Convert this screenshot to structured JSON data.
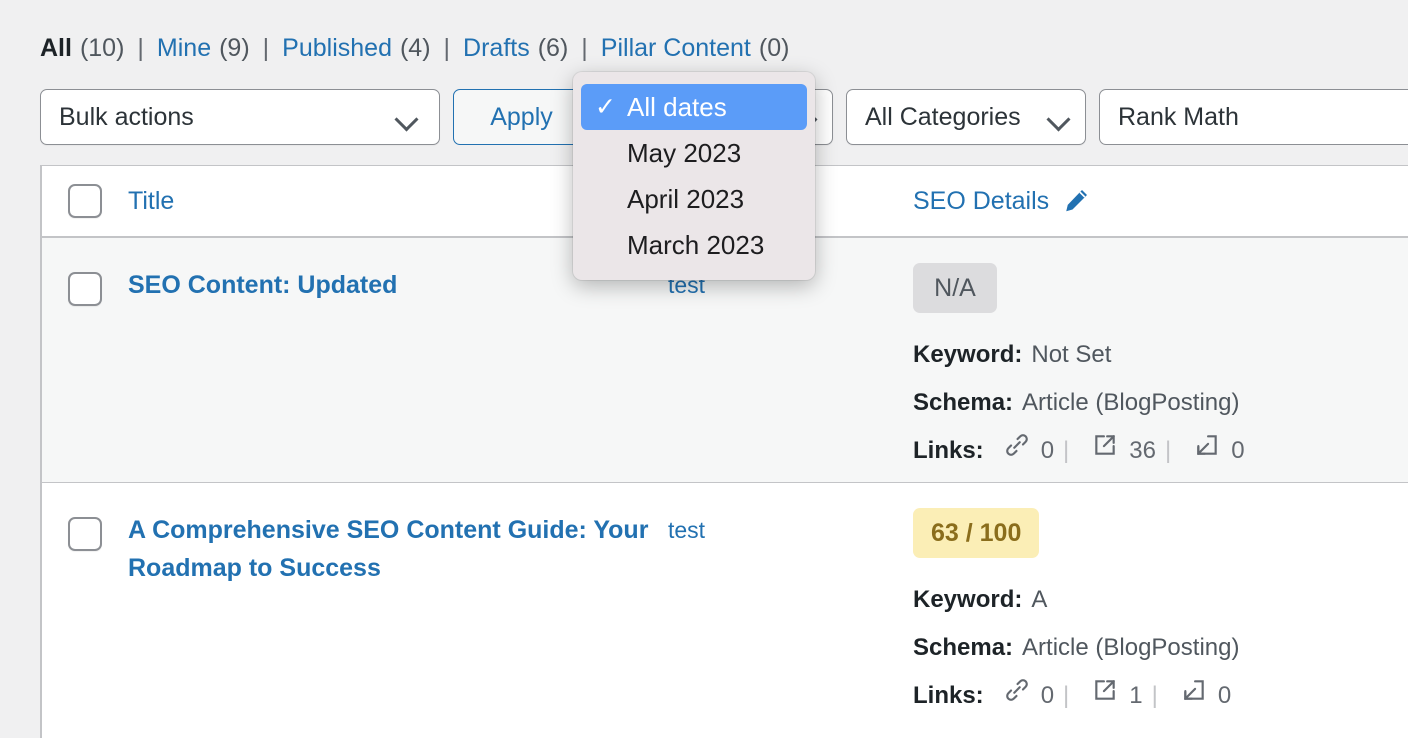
{
  "filters": {
    "separator": "|",
    "items": [
      {
        "label": "All",
        "count": "(10)",
        "current": true
      },
      {
        "label": "Mine",
        "count": "(9)",
        "current": false
      },
      {
        "label": "Published",
        "count": "(4)",
        "current": false
      },
      {
        "label": "Drafts",
        "count": "(6)",
        "current": false
      },
      {
        "label": "Pillar Content",
        "count": "(0)",
        "current": false
      }
    ]
  },
  "toolbar": {
    "bulk_actions_value": "Bulk actions",
    "apply_label": "Apply",
    "date_filter_value": "All dates",
    "category_filter_value": "All Categories",
    "rank_math_value": "Rank Math"
  },
  "date_dropdown": {
    "checkmark": "✓",
    "options": [
      {
        "label": "All dates",
        "selected": true
      },
      {
        "label": "May 2023",
        "selected": false
      },
      {
        "label": "April 2023",
        "selected": false
      },
      {
        "label": "March 2023",
        "selected": false
      }
    ]
  },
  "table": {
    "headers": {
      "title": "Title",
      "seo_details": "SEO Details"
    },
    "labels": {
      "keyword": "Keyword:",
      "schema": "Schema:",
      "links": "Links:",
      "separator": "|"
    },
    "rows": [
      {
        "title": "SEO Content: Updated",
        "category": "test",
        "score": "N/A",
        "score_type": "na",
        "keyword": "Not Set",
        "schema": "Article (BlogPosting)",
        "links_internal": "0",
        "links_external": "36",
        "links_incoming": "0"
      },
      {
        "title": "A Comprehensive SEO Content Guide: Your Roadmap to Success",
        "category": "test",
        "score": "63 / 100",
        "score_type": "ok",
        "keyword": "A",
        "schema": "Article (BlogPosting)",
        "links_internal": "0",
        "links_external": "1",
        "links_incoming": "0"
      }
    ]
  },
  "colors": {
    "link": "#2271b1",
    "page_bg": "#f0f0f1",
    "row_alt_bg": "#f6f7f7",
    "highlight_blue": "#5b9cf8",
    "score_ok_bg": "#fbeeb6",
    "score_ok_text": "#8a6d1c",
    "score_na_bg": "#dcdcde"
  }
}
